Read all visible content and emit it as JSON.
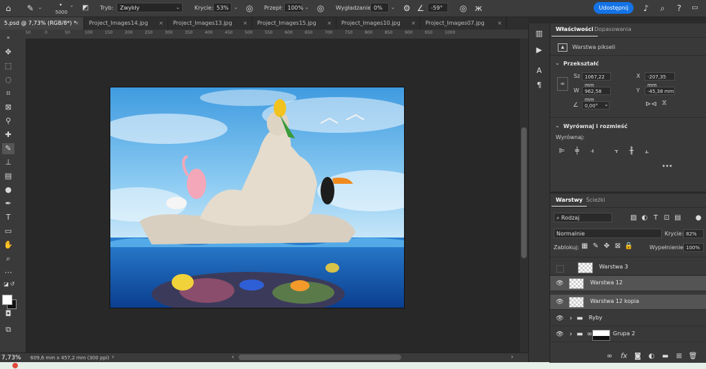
{
  "options": {
    "brush_size": "5000",
    "mode_label": "Tryb:",
    "mode_value": "Zwykły",
    "opacity_label": "Krycie:",
    "opacity_value": "53%",
    "flow_label": "Przepł:",
    "flow_value": "100%",
    "smoothing_label": "Wygładzanie:",
    "smoothing_value": "0%",
    "angle_value": "-59°",
    "share_label": "Udostępnij"
  },
  "tabs": [
    {
      "label": "5.psd @ 7,73% (RGB/8*) *"
    },
    {
      "label": "Project_Images14.jpg"
    },
    {
      "label": "Project_Images13.jpg"
    },
    {
      "label": "Project_Images15.jpg"
    },
    {
      "label": "Project_Images10.jpg"
    },
    {
      "label": "Project_Images07.jpg"
    }
  ],
  "ruler_ticks": [
    "50",
    "0",
    "50",
    "100",
    "150",
    "200",
    "250",
    "300",
    "350",
    "400",
    "450",
    "500",
    "550",
    "600",
    "650",
    "700",
    "750",
    "800",
    "850",
    "900",
    "950",
    "1000"
  ],
  "status": {
    "zoom": "7,73%",
    "doc_info": "609,6 mm x 457,2 mm (300 ppi)"
  },
  "properties": {
    "tab_active": "Właściwości",
    "tab_other": "Dopasowania",
    "pixel_layer": "Warstwa pikseli",
    "transform_title": "Przekształć",
    "w_label": "Sz",
    "w_value": "1067,22 mm",
    "h_label": "W",
    "h_value": "962,58 mm",
    "x_label": "X",
    "x_value": "-207,35 mm",
    "y_label": "Y",
    "y_value": "-45,38 mm",
    "angle_value": "0,00°",
    "align_title": "Wyrównaj i rozmieść",
    "align_label": "Wyrównaj:",
    "more": "•••"
  },
  "layers_panel": {
    "tab_active": "Warstwy",
    "tab_other": "Ścieżki",
    "filter_value": "Rodzaj",
    "blend_value": "Normalnie",
    "opacity_label": "Krycie:",
    "opacity_value": "82%",
    "lock_label": "Zablokuj:",
    "fill_label": "Wypełnienie:",
    "fill_value": "100%",
    "layers": [
      {
        "name": "Warstwa 3",
        "visible": false
      },
      {
        "name": "Warstwa 12",
        "visible": true
      },
      {
        "name": "Warstwa 12 kopia",
        "visible": true
      },
      {
        "name": "Ryby",
        "visible": true
      },
      {
        "name": "Grupa 2",
        "visible": true
      }
    ]
  }
}
